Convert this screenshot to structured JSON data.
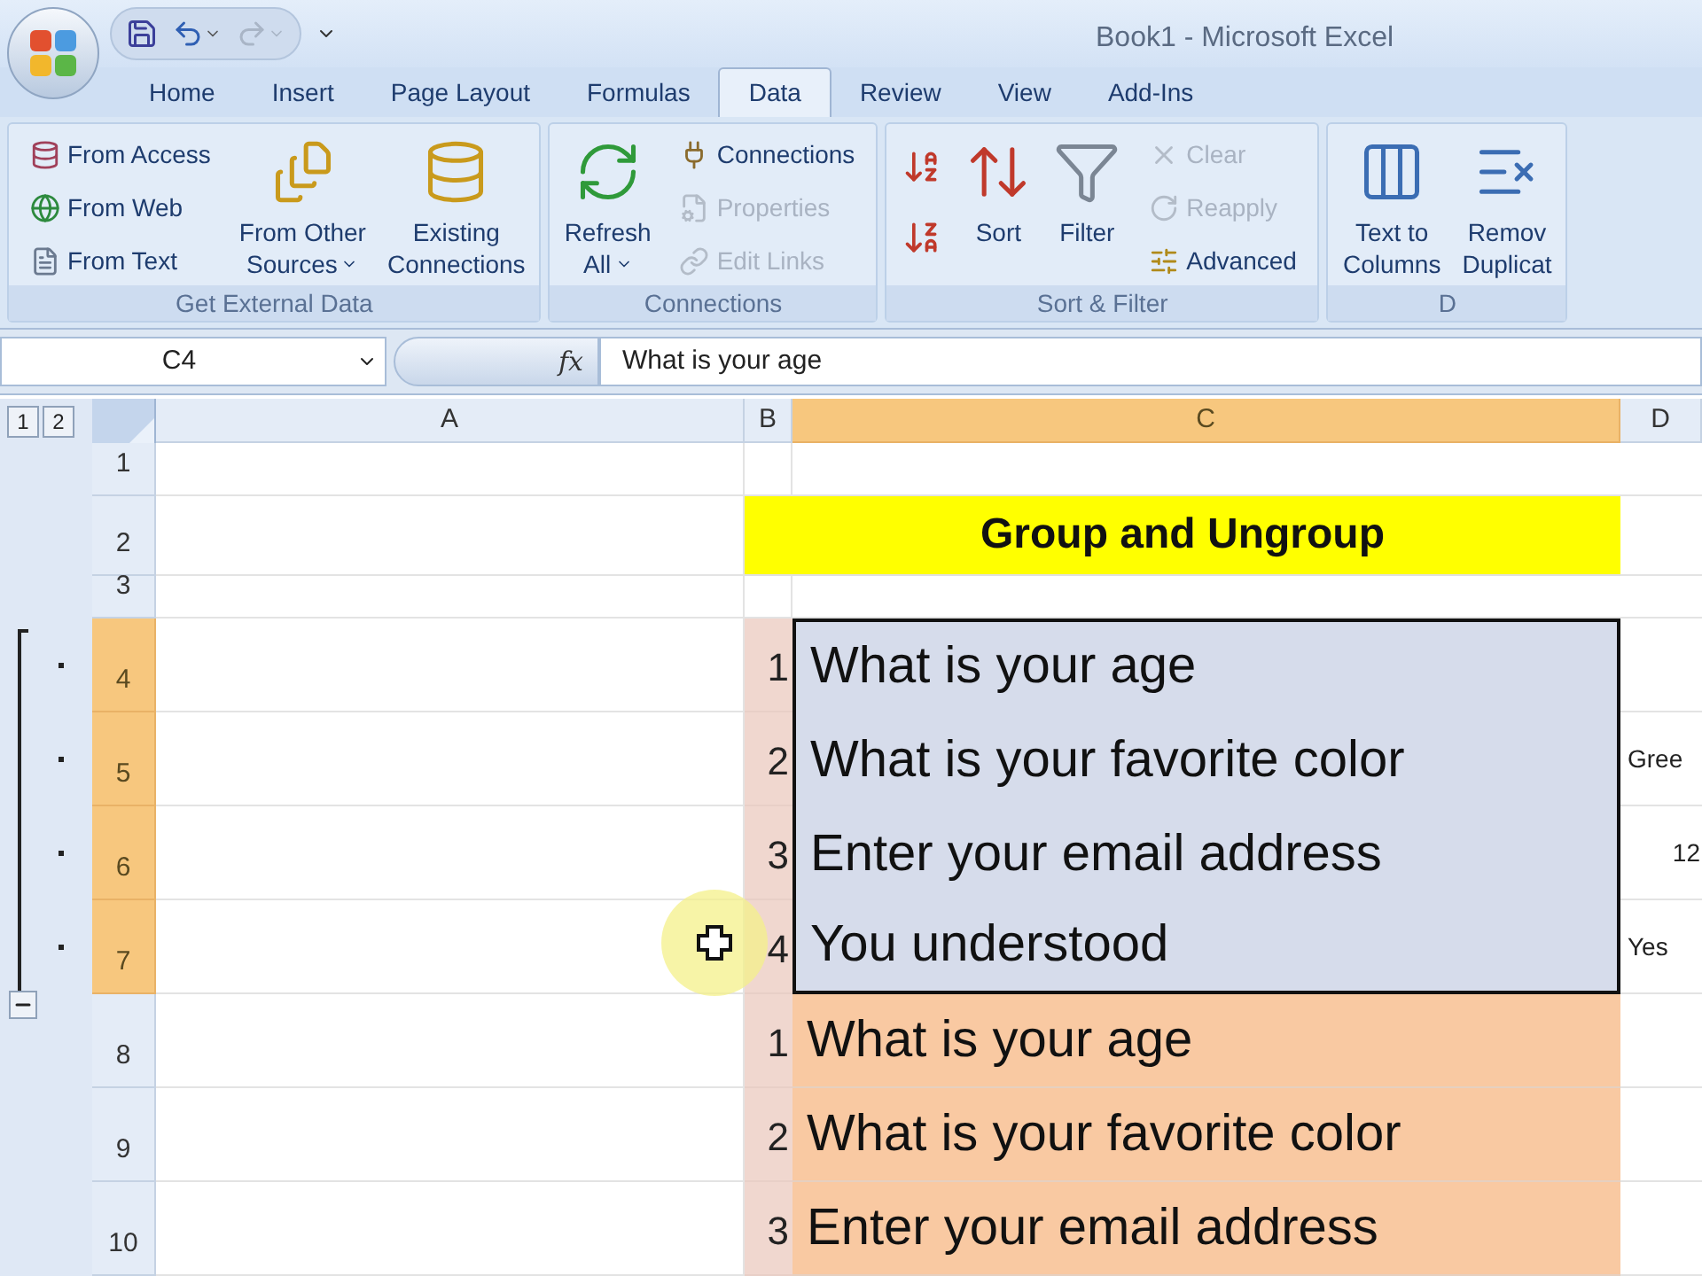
{
  "window": {
    "title": "Book1 - Microsoft Excel"
  },
  "tabs": [
    {
      "label": "Home",
      "selected": false
    },
    {
      "label": "Insert",
      "selected": false
    },
    {
      "label": "Page Layout",
      "selected": false
    },
    {
      "label": "Formulas",
      "selected": false
    },
    {
      "label": "Data",
      "selected": true
    },
    {
      "label": "Review",
      "selected": false
    },
    {
      "label": "View",
      "selected": false
    },
    {
      "label": "Add-Ins",
      "selected": false
    }
  ],
  "ribbon": [
    {
      "label": "Get External Data",
      "items": [
        {
          "kind": "stack",
          "buttons": [
            {
              "label": "From Access",
              "disabled": false
            },
            {
              "label": "From Web",
              "disabled": false
            },
            {
              "label": "From Text",
              "disabled": false
            }
          ]
        },
        {
          "kind": "large",
          "lines": [
            "From Other",
            "Sources"
          ],
          "dropdown": true
        },
        {
          "kind": "large",
          "lines": [
            "Existing",
            "Connections"
          ],
          "dropdown": false
        }
      ]
    },
    {
      "label": "Connections",
      "items": [
        {
          "kind": "large",
          "lines": [
            "Refresh",
            "All"
          ],
          "dropdown": true
        },
        {
          "kind": "stack",
          "buttons": [
            {
              "label": "Connections",
              "disabled": false
            },
            {
              "label": "Properties",
              "disabled": true
            },
            {
              "label": "Edit Links",
              "disabled": true
            }
          ]
        }
      ]
    },
    {
      "label": "Sort & Filter",
      "items": [
        {
          "kind": "sort_pair"
        },
        {
          "kind": "large",
          "lines": [
            "Sort"
          ],
          "dropdown": false
        },
        {
          "kind": "large",
          "lines": [
            "Filter"
          ],
          "dropdown": false
        },
        {
          "kind": "stack",
          "buttons": [
            {
              "label": "Clear",
              "disabled": true
            },
            {
              "label": "Reapply",
              "disabled": true
            },
            {
              "label": "Advanced",
              "disabled": false
            }
          ]
        }
      ]
    },
    {
      "label": "D",
      "items": [
        {
          "kind": "large",
          "lines": [
            "Text to",
            "Columns"
          ],
          "dropdown": false
        },
        {
          "kind": "large",
          "lines": [
            "Remov",
            "Duplicat"
          ],
          "dropdown": false
        }
      ]
    }
  ],
  "formula_bar": {
    "name_box": "C4",
    "function_label": "fx",
    "formula": "What is your age"
  },
  "outline": {
    "levels": [
      "1",
      "2"
    ],
    "expanded": true
  },
  "columns": [
    {
      "label": "A",
      "selected": false
    },
    {
      "label": "B",
      "selected": false
    },
    {
      "label": "C",
      "selected": true
    },
    {
      "label": "D",
      "selected": false
    }
  ],
  "rows": [
    {
      "label": "1",
      "selected": false,
      "kind": "blank"
    },
    {
      "label": "2",
      "selected": false,
      "kind": "title",
      "title": "Group and Ungroup"
    },
    {
      "label": "3",
      "selected": false,
      "kind": "blank"
    },
    {
      "label": "4",
      "selected": true,
      "kind": "item",
      "number": "1",
      "question": "What is your age",
      "cell_selected": true,
      "grouped": true
    },
    {
      "label": "5",
      "selected": true,
      "kind": "item",
      "number": "2",
      "question": "What is your favorite color",
      "answer": {
        "text": "Gree",
        "kind": "text"
      },
      "cell_selected": true,
      "grouped": true
    },
    {
      "label": "6",
      "selected": true,
      "kind": "item",
      "number": "3",
      "question": "Enter your email address",
      "answer": {
        "text": "12",
        "kind": "number"
      },
      "cell_selected": true,
      "grouped": true
    },
    {
      "label": "7",
      "selected": true,
      "kind": "item",
      "number": "4",
      "question": "You understood",
      "answer": {
        "text": "Yes",
        "kind": "text"
      },
      "cell_selected": true,
      "grouped": true
    },
    {
      "label": "8",
      "selected": false,
      "kind": "item",
      "number": "1",
      "question": "What is your age",
      "cell_selected": false,
      "grouped": false,
      "color": "#f9c9a2"
    },
    {
      "label": "9",
      "selected": false,
      "kind": "item",
      "number": "2",
      "question": "What is your favorite color",
      "cell_selected": false,
      "grouped": false,
      "color": "#f9c9a2"
    },
    {
      "label": "10",
      "selected": false,
      "kind": "item",
      "number": "3",
      "question": "Enter your email address",
      "cell_selected": false,
      "grouped": false,
      "color": "#f9c9a2"
    }
  ]
}
